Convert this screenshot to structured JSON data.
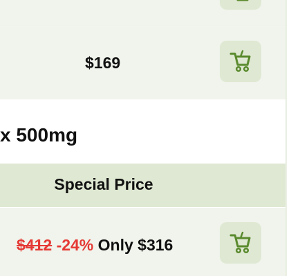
{
  "rows": [
    {
      "price": "$169",
      "cart_icon": "shopping-cart-icon"
    },
    {
      "old_price": "$412",
      "discount": "-24%",
      "price": "Only $316",
      "cart_icon": "shopping-cart-icon"
    }
  ],
  "product_title": "x 500mg",
  "special_header": "Special Price",
  "colors": {
    "row_bg": "#f0f4ec",
    "header_bg": "#dfe8d2",
    "button_bg": "#dfe8d2",
    "cart_green": "#5a8a2e",
    "sale_red": "#e53935"
  }
}
